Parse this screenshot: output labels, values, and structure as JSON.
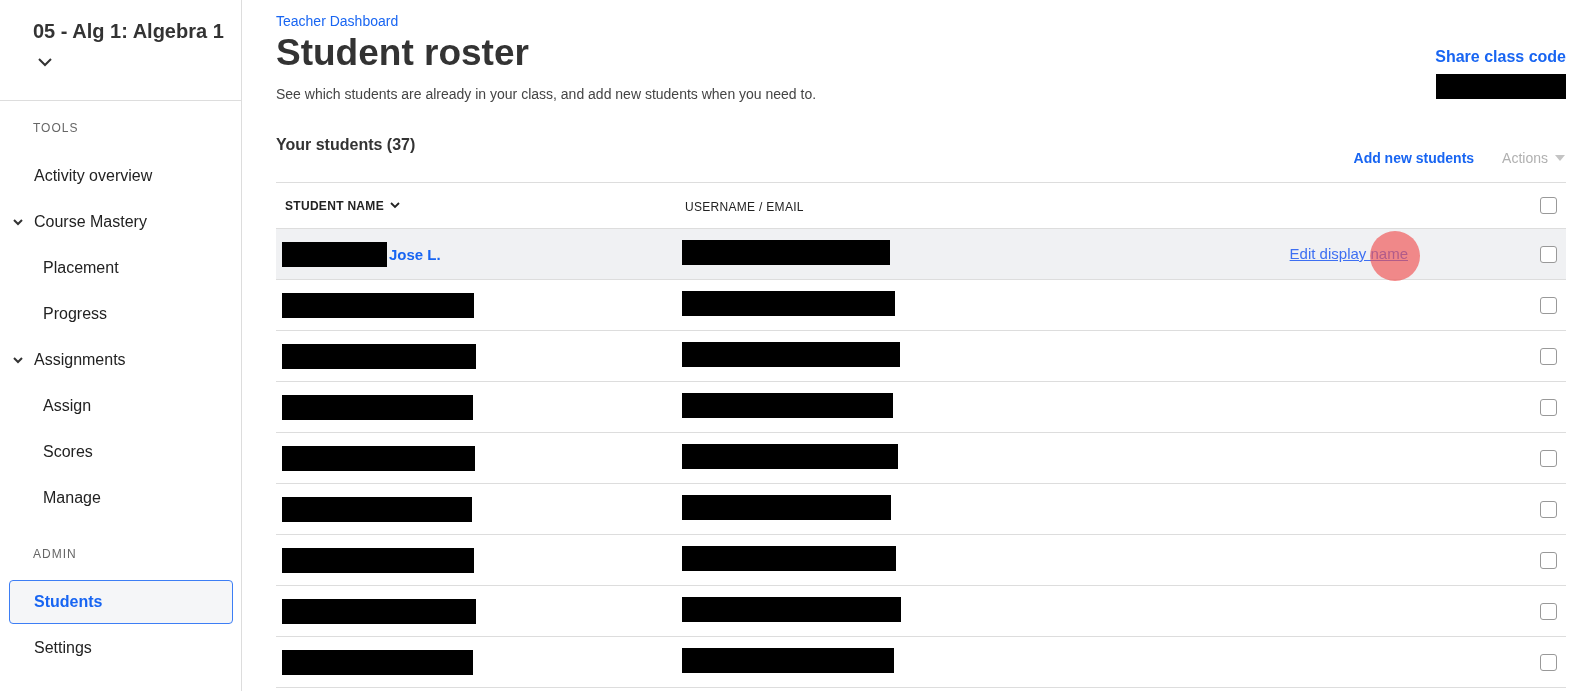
{
  "sidebar": {
    "course_title": "05 - Alg 1: Algebra 1",
    "sections": [
      {
        "heading": "TOOLS",
        "items": [
          {
            "label": "Activity overview",
            "selected": false
          },
          {
            "label": "Course Mastery",
            "selected": false,
            "expanded": true,
            "children": [
              {
                "label": "Placement",
                "selected": false
              },
              {
                "label": "Progress",
                "selected": false
              }
            ]
          },
          {
            "label": "Assignments",
            "selected": false,
            "expanded": true,
            "children": [
              {
                "label": "Assign",
                "selected": false
              },
              {
                "label": "Scores",
                "selected": false
              },
              {
                "label": "Manage",
                "selected": false
              }
            ]
          }
        ]
      },
      {
        "heading": "ADMIN",
        "items": [
          {
            "label": "Students",
            "selected": true
          },
          {
            "label": "Settings",
            "selected": false
          }
        ]
      }
    ]
  },
  "breadcrumb": "Teacher Dashboard",
  "title": "Student roster",
  "subtitle": "See which students are already in your class, and add new students when you need to.",
  "share_link": "Share class code",
  "students_heading": "Your students (37)",
  "add_link": "Add new students",
  "actions_menu": {
    "label": "Actions",
    "disabled": true
  },
  "table": {
    "columns": [
      "STUDENT NAME",
      "USERNAME / EMAIL"
    ],
    "all_checked": false,
    "rows": [
      {
        "name": "Jose L.",
        "hovered": true,
        "action": "Edit display name",
        "checked": false
      },
      {
        "hovered": false,
        "checked": false
      },
      {
        "hovered": false,
        "checked": false
      },
      {
        "hovered": false,
        "checked": false
      },
      {
        "hovered": false,
        "checked": false
      },
      {
        "hovered": false,
        "checked": false
      },
      {
        "hovered": false,
        "checked": false
      },
      {
        "hovered": false,
        "checked": false
      },
      {
        "hovered": false,
        "checked": false
      }
    ]
  }
}
